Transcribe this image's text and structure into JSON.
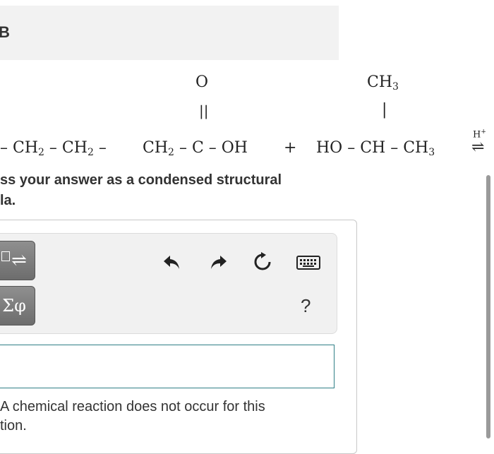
{
  "part": {
    "label": "B"
  },
  "equation": {
    "oxygen": "O",
    "double_bond": "||",
    "methyl": "CH",
    "methyl_sub": "3",
    "single_bond": "|",
    "seg1": "– CH",
    "seg1_sub": "2",
    "seg2": " – CH",
    "seg2_sub": "2",
    "seg2_dash": "–",
    "seg3": "CH",
    "seg3_sub": "2",
    "seg3_rest": " – C – OH",
    "plus": "+",
    "alcohol": "HO – CH – CH",
    "alcohol_sub": "3",
    "catalyst": "H",
    "catalyst_sup": "+",
    "equilibrium": "⇌"
  },
  "prompt": {
    "line1": "ss your answer as a condensed structural",
    "line2": "la."
  },
  "toolbar": {
    "template_button": "⇌",
    "greek_button": "Σφ",
    "icons": [
      "undo-icon",
      "redo-icon",
      "reset-icon",
      "keyboard-icon"
    ],
    "help": "?"
  },
  "answer": {
    "value": ""
  },
  "no_reaction": {
    "line1": "A chemical reaction does not occur for this",
    "line2": "tion."
  }
}
